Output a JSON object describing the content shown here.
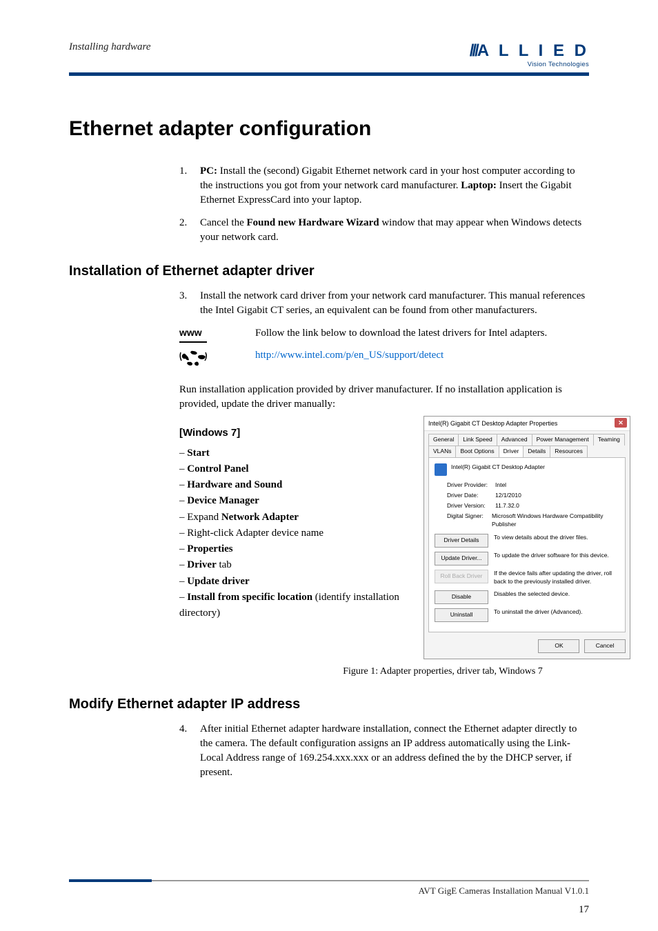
{
  "header": {
    "section": "Installing hardware",
    "logo_main": "A L L I E D",
    "logo_slash": "///",
    "logo_sub": "Vision Technologies"
  },
  "h1": "Ethernet adapter configuration",
  "steps_a": [
    {
      "n": "1.",
      "html": "<b>PC:</b> Install the (second) Gigabit Ethernet network card in your host computer according to the instructions you got from your network card manufacturer. <b>Laptop:</b> Insert the Gigabit Ethernet ExpressCard into your laptop."
    },
    {
      "n": "2.",
      "html": "Cancel the <b>Found new Hardware Wizard</b> window that may appear when Windows detects your network card."
    }
  ],
  "h2_install": "Installation of Ethernet adapter driver",
  "steps_b": [
    {
      "n": "3.",
      "html": "Install the network card driver from your network card manufacturer. This manual references the Intel Gigabit CT series, an equivalent can be found from other manufacturers."
    }
  ],
  "www": {
    "label": "www",
    "text": "Follow the link below to download the latest drivers for Intel adapters.",
    "link": "http://www.intel.com/p/en_US/support/detect"
  },
  "para_run": "Run installation application provided by driver manufacturer. If no installation application is provided, update the driver manually:",
  "h3_win7": "[Windows 7]",
  "win7_steps": [
    "<b>Start</b>",
    "<b>Control Panel</b>",
    "<b>Hardware and Sound</b>",
    "<b>Device Manager</b>",
    "Expand <b>Network Adapter</b>",
    "Right-click Adapter device name",
    "<b>Properties</b>",
    "<b>Driver</b> tab",
    "<b>Update driver</b>",
    "<b>Install from specific location</b> (identify installation directory)"
  ],
  "dialog": {
    "title": "Intel(R) Gigabit CT Desktop Adapter Properties",
    "tabs_row1": [
      "General",
      "Link Speed",
      "Advanced",
      "Power Management"
    ],
    "tabs_row2": [
      "Teaming",
      "VLANs",
      "Boot Options",
      "Driver",
      "Details",
      "Resources"
    ],
    "active_tab": "Driver",
    "device": "Intel(R) Gigabit CT Desktop Adapter",
    "info": [
      {
        "l": "Driver Provider:",
        "v": "Intel"
      },
      {
        "l": "Driver Date:",
        "v": "12/1/2010"
      },
      {
        "l": "Driver Version:",
        "v": "11.7.32.0"
      },
      {
        "l": "Digital Signer:",
        "v": "Microsoft Windows Hardware Compatibility Publisher"
      }
    ],
    "buttons": [
      {
        "label": "Driver Details",
        "desc": "To view details about the driver files.",
        "disabled": false
      },
      {
        "label": "Update Driver...",
        "desc": "To update the driver software for this device.",
        "disabled": false
      },
      {
        "label": "Roll Back Driver",
        "desc": "If the device fails after updating the driver, roll back to the previously installed driver.",
        "disabled": true
      },
      {
        "label": "Disable",
        "desc": "Disables the selected device.",
        "disabled": false
      },
      {
        "label": "Uninstall",
        "desc": "To uninstall the driver (Advanced).",
        "disabled": false
      }
    ],
    "ok": "OK",
    "cancel": "Cancel"
  },
  "caption": "Figure 1: Adapter properties, driver tab, Windows 7",
  "h2_modify": "Modify Ethernet adapter IP address",
  "steps_c": [
    {
      "n": "4.",
      "html": "After initial Ethernet adapter hardware installation, connect the Ethernet adapter directly to the camera. The default configuration assigns an IP address automatically using the Link-Local Address range of 169.254.xxx.xxx or an address defined the by the DHCP server, if present."
    }
  ],
  "footer": {
    "text": "AVT GigE Cameras Installation Manual V1.0.1",
    "page": "17"
  }
}
